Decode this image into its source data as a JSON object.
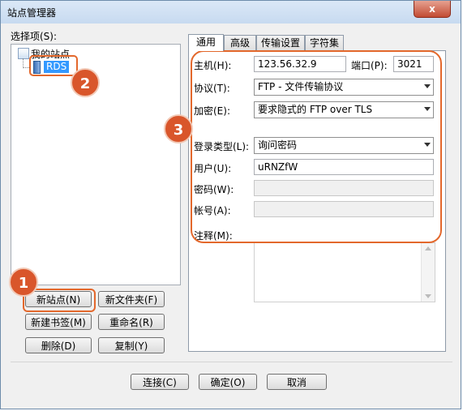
{
  "window": {
    "title": "站点管理器",
    "close_glyph": "x"
  },
  "left_panel": {
    "select_label": "选择项(S):",
    "tree": {
      "root_label": "我的站点",
      "child_label": "RDS"
    },
    "buttons": {
      "new_site": "新站点(N)",
      "new_folder": "新文件夹(F)",
      "new_bookmark": "新建书签(M)",
      "rename": "重命名(R)",
      "delete": "删除(D)",
      "copy": "复制(Y)"
    }
  },
  "tabs": [
    "通用",
    "高级",
    "传输设置",
    "字符集"
  ],
  "general": {
    "host_label": "主机(H):",
    "host_value": "123.56.32.9",
    "port_label": "端口(P):",
    "port_value": "3021",
    "protocol_label": "协议(T):",
    "protocol_value": "FTP - 文件传输协议",
    "encryption_label": "加密(E):",
    "encryption_value": "要求隐式的 FTP over TLS",
    "logon_type_label": "登录类型(L):",
    "logon_type_value": "询问密码",
    "user_label": "用户(U):",
    "user_value": "uRNZfW",
    "password_label": "密码(W):",
    "account_label": "帐号(A):",
    "notes_label": "注释(M):"
  },
  "footer": {
    "connect": "连接(C)",
    "ok": "确定(O)",
    "cancel": "取消"
  },
  "annotations": {
    "badge1": "1",
    "badge2": "2",
    "badge3": "3"
  },
  "colors": {
    "callout": "#e3682c",
    "badge": "#d9562b",
    "selection": "#3399ff"
  }
}
